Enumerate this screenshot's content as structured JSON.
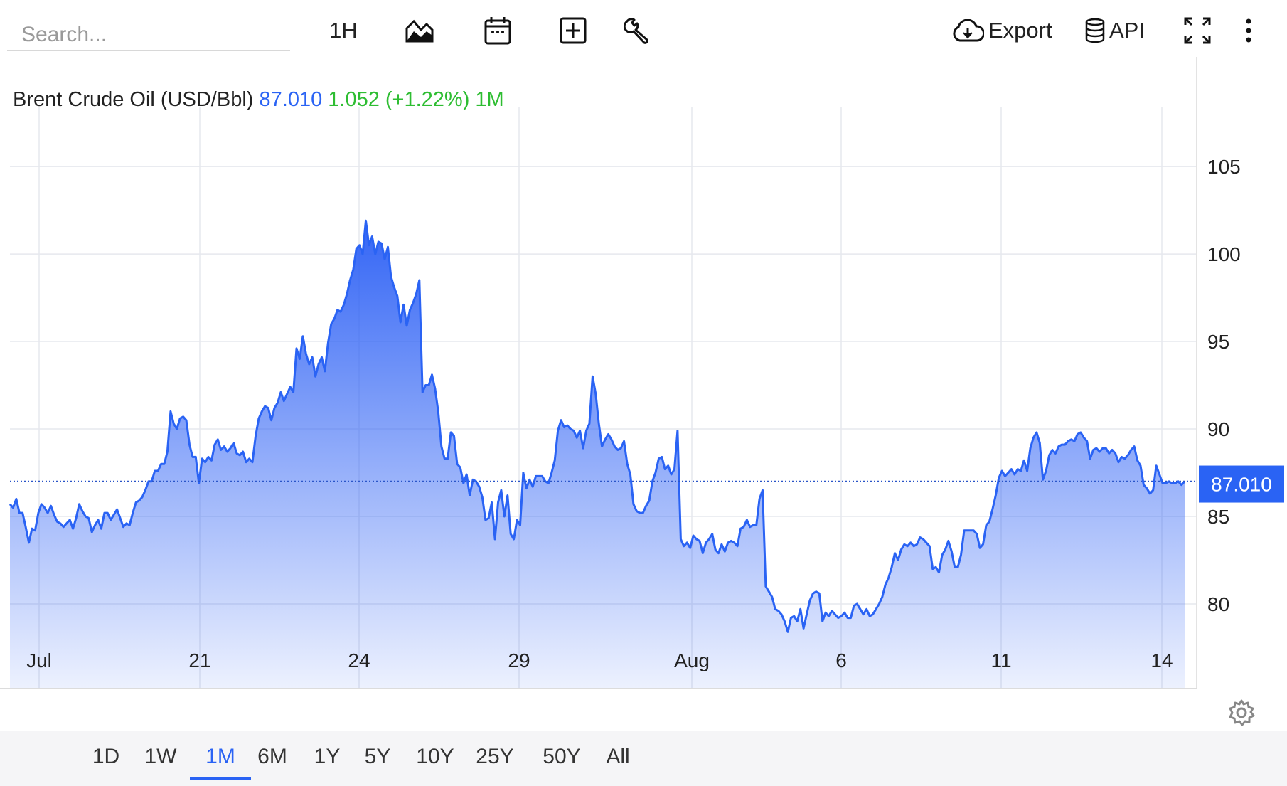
{
  "toolbar": {
    "search_placeholder": "Search...",
    "interval_label": "1H",
    "export_label": "Export",
    "api_label": "API",
    "icons": [
      "chart-type-icon",
      "calendar-icon",
      "add-compare-icon",
      "wrench-icon",
      "cloud-download-icon",
      "database-icon",
      "fullscreen-icon",
      "more-vertical-icon"
    ]
  },
  "legend": {
    "name": "Brent Crude Oil (USD/Bbl)",
    "last": "87.010",
    "change": "1.052 (+1.22%) 1M"
  },
  "price_tag": "87.010",
  "colors": {
    "line": "#2a63f4",
    "area_top": "#2f62f5",
    "area_bottom": "#e9eefe",
    "up": "#2ebd32",
    "tag_bg": "#2a63f4"
  },
  "ranges": [
    "1D",
    "1W",
    "1M",
    "6M",
    "1Y",
    "5Y",
    "10Y",
    "25Y",
    "50Y",
    "All"
  ],
  "active_range": "1M",
  "chart_data": {
    "type": "area",
    "title": "Brent Crude Oil (USD/Bbl)",
    "ylim": [
      75.2,
      107.2
    ],
    "yticks": [
      80,
      85,
      90,
      95,
      100,
      105
    ],
    "xticks": [
      "Jul",
      "21",
      "24",
      "29",
      "Aug",
      "6",
      "11",
      "14"
    ],
    "grid": true,
    "last_value": 87.01,
    "x_label": "",
    "y_label": "",
    "series": [
      {
        "values": [
          85.7,
          85.5,
          86.0,
          85.2,
          85.2,
          84.4,
          83.5,
          84.3,
          84.2,
          85.2,
          85.7,
          85.5,
          85.2,
          85.6,
          85.1,
          84.7,
          84.6,
          84.4,
          84.6,
          84.8,
          84.3,
          84.9,
          85.7,
          85.3,
          85.0,
          84.9,
          84.1,
          84.5,
          84.8,
          84.3,
          85.2,
          85.2,
          84.8,
          85.1,
          85.4,
          84.9,
          84.4,
          84.6,
          84.5,
          85.2,
          85.8,
          85.9,
          86.1,
          86.5,
          87.0,
          87.0,
          87.6,
          87.6,
          88.0,
          88.0,
          88.7,
          91.0,
          90.3,
          90.0,
          90.6,
          90.7,
          90.5,
          89.1,
          88.4,
          88.4,
          86.9,
          88.3,
          88.1,
          88.4,
          88.2,
          89.1,
          89.4,
          88.8,
          89.0,
          88.7,
          88.9,
          89.2,
          88.6,
          88.5,
          88.7,
          88.1,
          88.3,
          88.1,
          89.6,
          90.6,
          91.0,
          91.3,
          91.2,
          90.5,
          91.2,
          91.5,
          92.1,
          91.6,
          92.0,
          92.4,
          92.1,
          94.6,
          94.0,
          95.3,
          94.3,
          93.7,
          94.1,
          93.0,
          93.7,
          94.1,
          93.3,
          94.9,
          96.0,
          96.3,
          96.8,
          96.7,
          97.1,
          97.7,
          98.5,
          99.1,
          100.3,
          100.5,
          100.0,
          101.9,
          100.5,
          101.0,
          100.0,
          100.7,
          100.6,
          99.7,
          100.4,
          98.7,
          98.1,
          97.6,
          96.1,
          97.1,
          95.9,
          96.8,
          97.2,
          97.7,
          98.5,
          92.1,
          92.5,
          92.5,
          93.1,
          92.3,
          91.0,
          89.0,
          88.3,
          88.3,
          89.8,
          89.6,
          88.0,
          87.8,
          86.9,
          87.4,
          86.2,
          87.1,
          87.0,
          86.7,
          86.1,
          84.8,
          84.9,
          85.8,
          83.7,
          85.8,
          86.5,
          85.0,
          86.2,
          84.0,
          83.7,
          84.8,
          84.5,
          87.5,
          86.6,
          87.1,
          86.7,
          87.3,
          87.3,
          87.3,
          87.0,
          86.9,
          87.5,
          88.2,
          89.9,
          90.5,
          90.1,
          90.2,
          90.0,
          89.9,
          89.5,
          89.9,
          88.9,
          89.9,
          90.3,
          93.0,
          92.0,
          90.3,
          89.0,
          89.4,
          89.7,
          89.4,
          89.0,
          88.8,
          88.9,
          89.3,
          88.0,
          87.4,
          85.7,
          85.3,
          85.2,
          85.2,
          85.6,
          85.9,
          87.0,
          87.5,
          88.3,
          88.4,
          87.7,
          87.9,
          87.4,
          87.7,
          89.9,
          83.7,
          83.3,
          83.5,
          83.2,
          83.9,
          83.7,
          83.6,
          82.9,
          83.5,
          83.7,
          84.0,
          83.1,
          82.9,
          83.4,
          83.0,
          83.5,
          83.6,
          83.5,
          83.3,
          84.3,
          84.4,
          84.8,
          84.4,
          84.5,
          84.5,
          86.0,
          86.5,
          81.0,
          80.7,
          80.4,
          79.7,
          79.6,
          79.4,
          79.0,
          78.4,
          79.2,
          79.3,
          79.0,
          79.7,
          78.6,
          79.4,
          80.2,
          80.6,
          80.7,
          80.6,
          79.0,
          79.5,
          79.3,
          79.6,
          79.4,
          79.2,
          79.3,
          79.5,
          79.2,
          79.2,
          79.9,
          80.0,
          79.7,
          79.4,
          79.7,
          79.3,
          79.4,
          79.7,
          80.0,
          80.4,
          81.1,
          81.5,
          82.1,
          82.9,
          82.5,
          83.1,
          83.4,
          83.3,
          83.5,
          83.3,
          83.4,
          83.8,
          83.7,
          83.5,
          83.3,
          82.0,
          82.1,
          81.8,
          82.8,
          83.1,
          83.6,
          83.0,
          82.1,
          82.1,
          82.8,
          84.2,
          84.2,
          84.2,
          84.2,
          84.0,
          83.2,
          83.4,
          84.5,
          84.7,
          85.4,
          86.2,
          87.2,
          87.6,
          87.3,
          87.5,
          87.7,
          87.4,
          87.7,
          87.6,
          88.2,
          87.6,
          88.9,
          89.5,
          89.8,
          89.2,
          87.1,
          87.6,
          88.5,
          88.8,
          88.6,
          89.0,
          89.1,
          89.1,
          89.3,
          89.4,
          89.3,
          89.7,
          89.8,
          89.5,
          89.3,
          88.3,
          88.8,
          88.9,
          88.7,
          88.9,
          88.9,
          88.6,
          88.8,
          88.6,
          88.1,
          88.4,
          88.3,
          88.5,
          88.8,
          89.0,
          88.2,
          87.9,
          86.8,
          86.6,
          86.3,
          86.5,
          87.9,
          87.4,
          86.9,
          86.9,
          87.0,
          86.9,
          86.9,
          87.0,
          86.8,
          87.0
        ]
      }
    ]
  }
}
